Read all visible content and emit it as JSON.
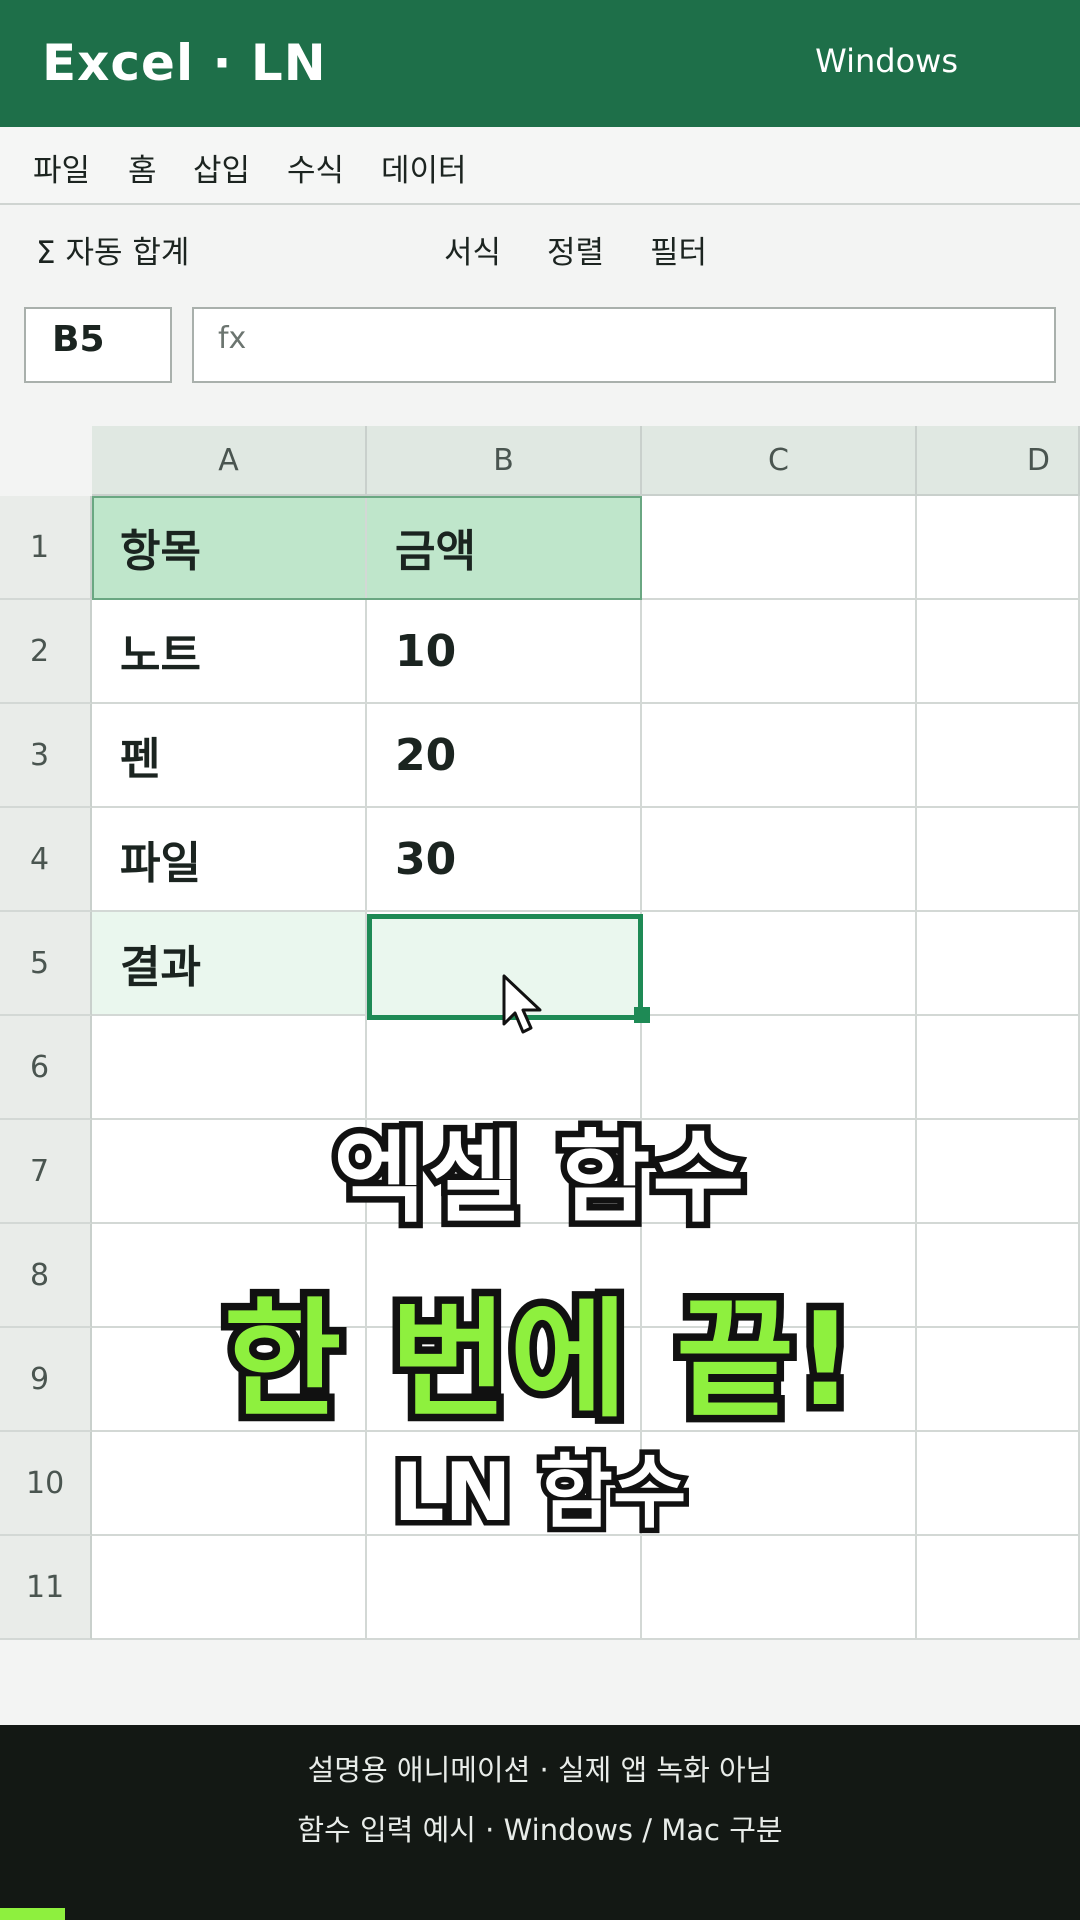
{
  "titlebar": {
    "app_title": "Excel · LN",
    "platform": "Windows",
    "color": "#1e6f49"
  },
  "menu": [
    "파일",
    "홈",
    "삽입",
    "수식",
    "데이터"
  ],
  "ribbon": {
    "autosum": "Σ 자동 합계",
    "format": "서식",
    "sort": "정렬",
    "filter": "필터"
  },
  "formula_bar": {
    "name_box": "B5",
    "fx_label": "fx",
    "formula": ""
  },
  "sheet": {
    "columns": [
      "A",
      "B",
      "C",
      "D"
    ],
    "rows": [
      "1",
      "2",
      "3",
      "4",
      "5",
      "6",
      "7",
      "8",
      "9",
      "10",
      "11"
    ],
    "cells": {
      "A1": "항목",
      "B1": "금액",
      "A2": "노트",
      "B2": "10",
      "A3": "펜",
      "B3": "20",
      "A4": "파일",
      "B4": "30",
      "A5": "결과",
      "B5": ""
    },
    "selected_cell": "B5"
  },
  "overlay": {
    "line1": "엑셀 함수",
    "line2": "한 번에 끝!",
    "line3": "LN 함수",
    "accent": "#8ef03e"
  },
  "footer": {
    "line1": "설명용 애니메이션 · 실제 앱 녹화 아님",
    "line2": "함수 입력 예시 · Windows / Mac 구분"
  },
  "progress": {
    "fraction": 0.06
  }
}
